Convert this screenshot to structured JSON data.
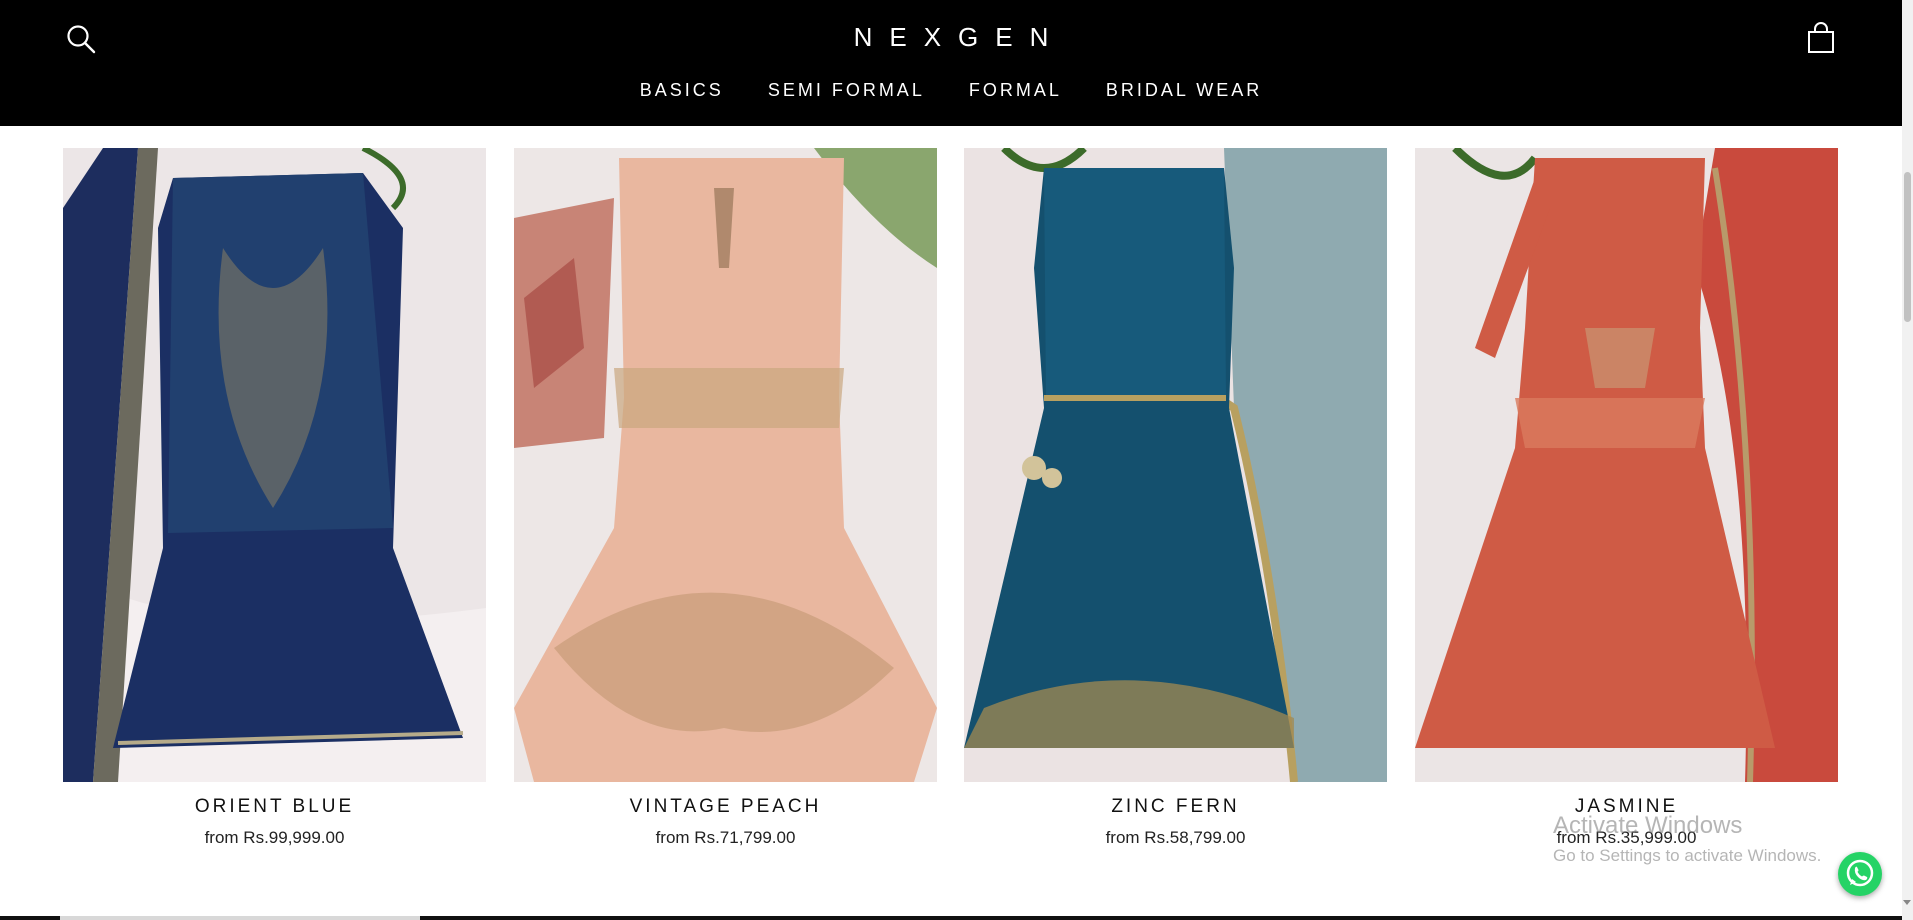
{
  "header": {
    "logo": "NEXGEN",
    "search_icon": "search-icon",
    "cart_icon": "cart-icon",
    "background_color": "#000000",
    "nav": [
      {
        "label": "BASICS"
      },
      {
        "label": "SEMI FORMAL"
      },
      {
        "label": "FORMAL"
      },
      {
        "label": "BRIDAL WEAR"
      }
    ]
  },
  "products": [
    {
      "title": "ORIENT BLUE",
      "price": "from Rs.99,999.00",
      "color": "#1b2f63"
    },
    {
      "title": "VINTAGE PEACH",
      "price": "from Rs.71,799.00",
      "color": "#e8b59b"
    },
    {
      "title": "ZINC FERN",
      "price": "from Rs.58,799.00",
      "color": "#14506e"
    },
    {
      "title": "JASMINE",
      "price": "from Rs.35,999.00",
      "color": "#cf5b45"
    }
  ],
  "watermark": {
    "title": "Activate Windows",
    "subtitle": "Go to Settings to activate Windows."
  },
  "whatsapp": {
    "icon": "whatsapp-icon",
    "color": "#25d366"
  }
}
